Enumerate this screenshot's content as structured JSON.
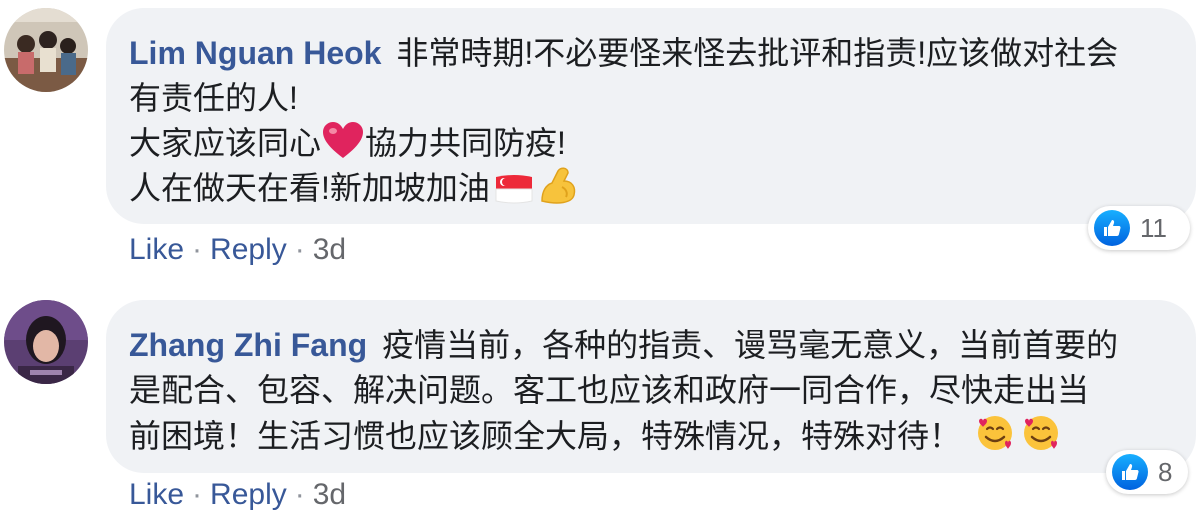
{
  "comments": [
    {
      "author": "Lim Nguan Heok",
      "line1": "非常時期!不必要怪来怪去批评和指责!应该做对社会",
      "line2": "有责任的人!",
      "line3a": "大家应该同心",
      "line3b": "協力共同防疫!",
      "line4": "人在做天在看!新加坡加油",
      "reaction_count": "11",
      "like_label": "Like",
      "reply_label": "Reply",
      "separator": "·",
      "time": "3d"
    },
    {
      "author": "Zhang Zhi Fang",
      "line1": "疫情当前，各种的指责、谩骂毫无意义，当前首要的",
      "line2": "是配合、包容、解决问题。客工也应该和政府一同合作，尽快走出当",
      "line3": "前困境！生活习惯也应该顾全大局，特殊情况，特殊对待！",
      "reaction_count": "8",
      "like_label": "Like",
      "reply_label": "Reply",
      "separator": "·",
      "time": "3d"
    }
  ],
  "colors": {
    "author": "#385898",
    "bubble": "#f0f2f5",
    "text": "#1c1e21",
    "like_blue": "#1877f2"
  },
  "icons": [
    "thumbs-up-icon",
    "red-heart-emoji",
    "singapore-flag-emoji",
    "flexed-biceps-emoji",
    "smiling-face-with-hearts-emoji"
  ]
}
